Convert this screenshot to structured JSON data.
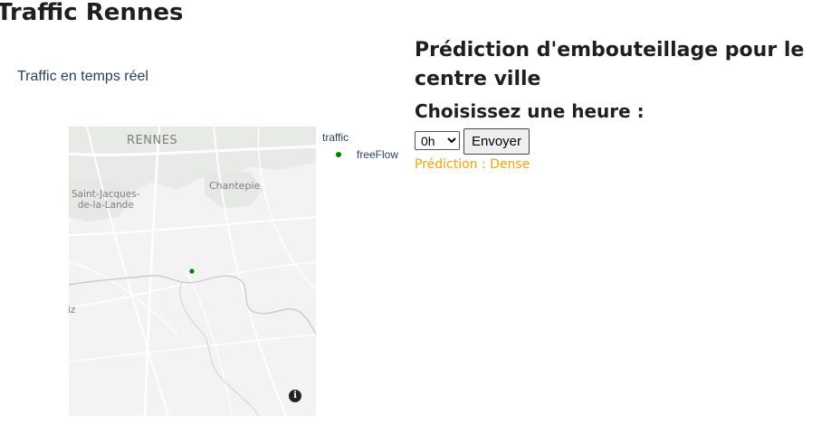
{
  "app": {
    "title": "Traffic Rennes"
  },
  "left": {
    "realtime_label": "Traffic en temps réel",
    "map": {
      "labels": {
        "rennes": "RENNES",
        "chantepie": "Chantepie",
        "saint_jacques_line1": "Saint-Jacques-",
        "saint_jacques_line2": "de-la-Lande",
        "partial_left": "iz"
      },
      "info_icon": "info-icon",
      "marker_color": "#008000"
    },
    "legend": {
      "title": "traffic",
      "items": [
        {
          "label": "freeFlow",
          "color": "#008000"
        }
      ]
    }
  },
  "right": {
    "prediction_heading": "Prédiction d'embouteillage pour le centre ville",
    "choose_heading": "Choisissez une heure :",
    "hour_select": {
      "selected": "0h"
    },
    "send_label": "Envoyer",
    "result": "Prédiction : Dense",
    "result_color": "#f0a30a"
  }
}
